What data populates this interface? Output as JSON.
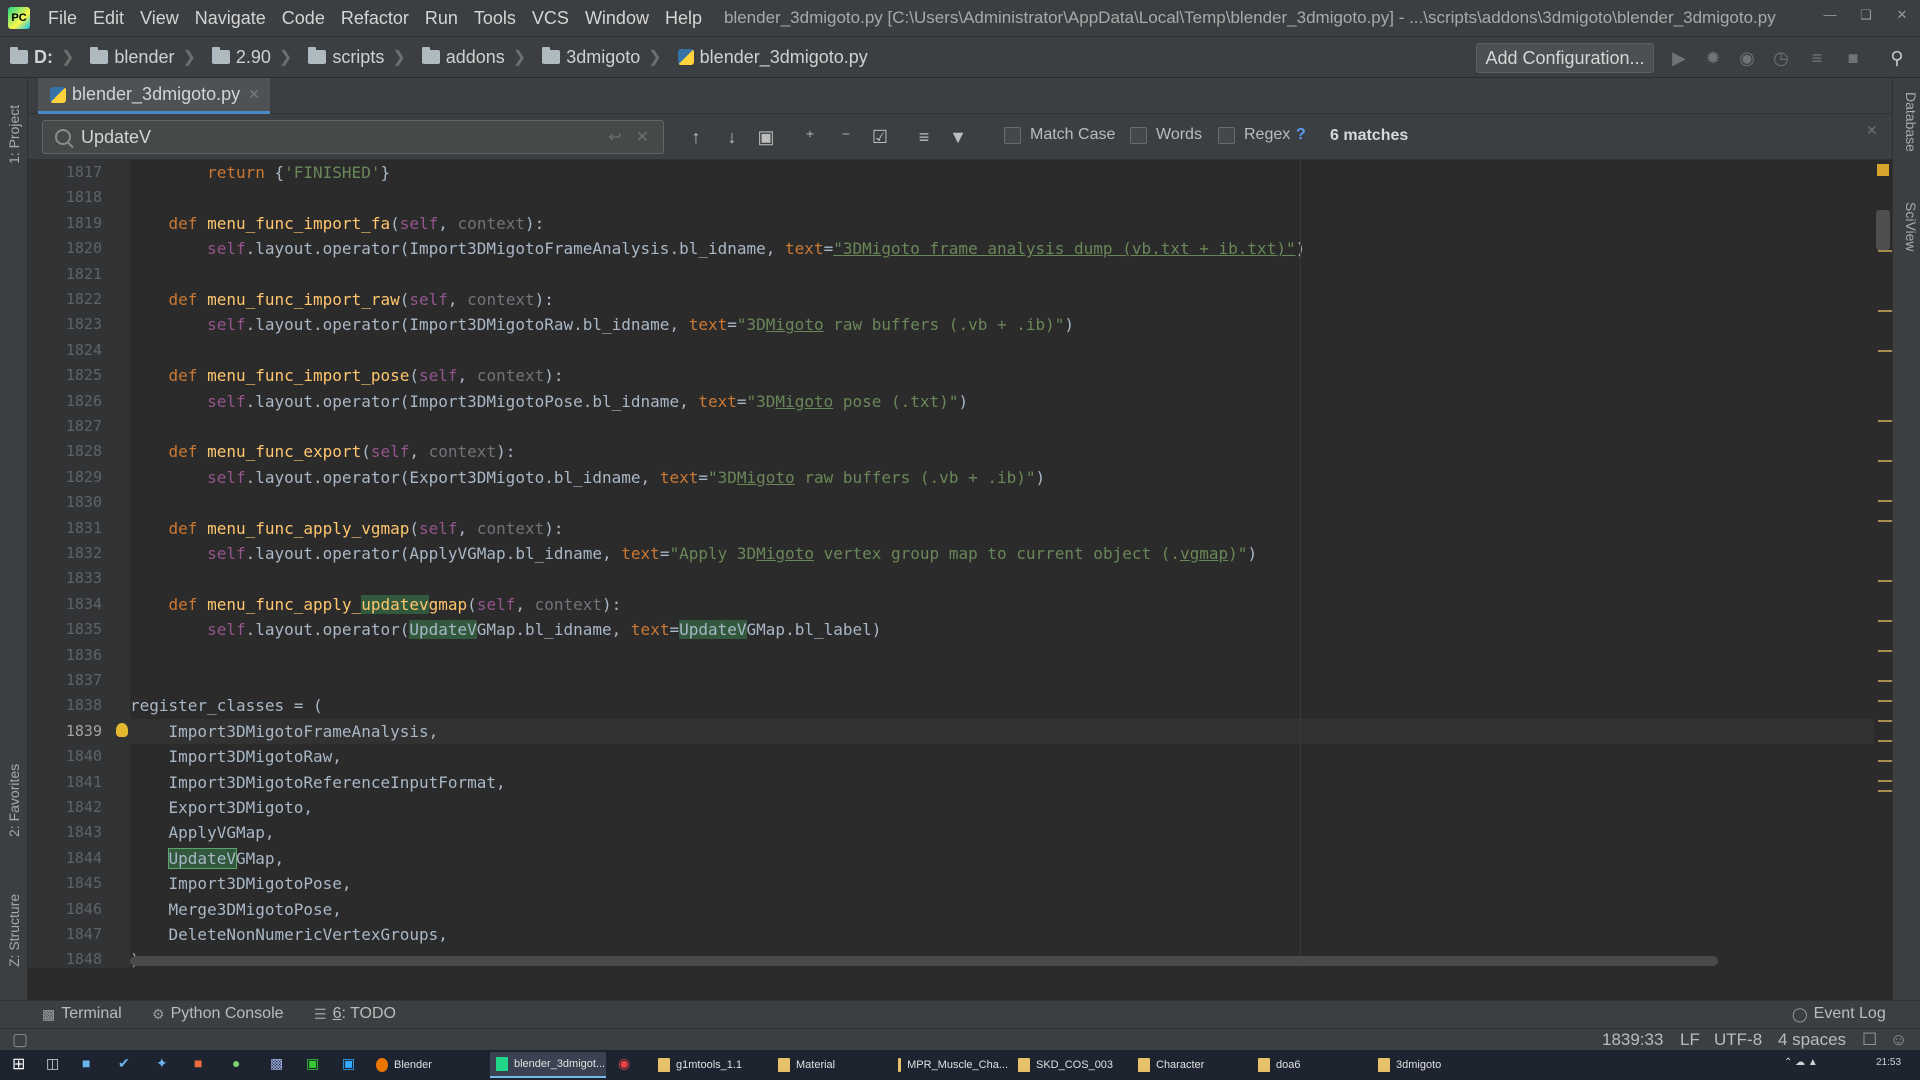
{
  "window": {
    "title": "blender_3dmigoto.py [C:\\Users\\Administrator\\AppData\\Local\\Temp\\blender_3dmigoto.py] - ...\\scripts\\addons\\3dmigoto\\blender_3dmigoto.py",
    "menu": [
      "File",
      "Edit",
      "View",
      "Navigate",
      "Code",
      "Refactor",
      "Run",
      "Tools",
      "VCS",
      "Window",
      "Help"
    ]
  },
  "breadcrumbs": [
    "D:",
    "blender",
    "2.90",
    "scripts",
    "addons",
    "3dmigoto",
    "blender_3dmigoto.py"
  ],
  "toolbar": {
    "add_configuration": "Add Configuration..."
  },
  "tool_windows": {
    "project": "1: Project",
    "favorites": "2: Favorites",
    "structure": "Z: Structure",
    "database": "Database",
    "sciview": "SciView"
  },
  "editor_tab": {
    "label": "blender_3dmigoto.py"
  },
  "search": {
    "value": "UpdateV",
    "match_case_label": "Match Case",
    "words_label": "Words",
    "regex_label": "Regex",
    "help": "?",
    "matches": "6 matches"
  },
  "line_numbers": [
    "1817",
    "1818",
    "1819",
    "1820",
    "1821",
    "1822",
    "1823",
    "1824",
    "1825",
    "1826",
    "1827",
    "1828",
    "1829",
    "1830",
    "1831",
    "1832",
    "1833",
    "1834",
    "1835",
    "1836",
    "1837",
    "1838",
    "1839",
    "1840",
    "1841",
    "1842",
    "1843",
    "1844",
    "1845",
    "1846",
    "1847",
    "1848"
  ],
  "code": {
    "l1817": [
      "        ",
      "return",
      " {",
      "'FINISHED'",
      "}"
    ],
    "l1819": [
      "    ",
      "def",
      " ",
      "menu_func_import_fa",
      "(",
      "self",
      ", ",
      "context",
      "):"
    ],
    "l1820": [
      "        ",
      "self",
      ".layout.operator(Import3DMigotoFrameAnalysis.bl_idname, ",
      "text",
      "=",
      "\"3DMigoto frame analysis dump (vb.txt + ib.txt)\"",
      ")"
    ],
    "l1822": [
      "    ",
      "def",
      " ",
      "menu_func_import_raw",
      "(",
      "self",
      ", ",
      "context",
      "):"
    ],
    "l1823": [
      "        ",
      "self",
      ".layout.operator(Import3DMigotoRaw.bl_idname, ",
      "text",
      "=",
      "\"3D",
      "Migoto",
      " raw buffers (.vb + .ib)\"",
      ")"
    ],
    "l1825": [
      "    ",
      "def",
      " ",
      "menu_func_import_pose",
      "(",
      "self",
      ", ",
      "context",
      "):"
    ],
    "l1826": [
      "        ",
      "self",
      ".layout.operator(Import3DMigotoPose.bl_idname, ",
      "text",
      "=",
      "\"3D",
      "Migoto",
      " pose (.txt)\"",
      ")"
    ],
    "l1828": [
      "    ",
      "def",
      " ",
      "menu_func_export",
      "(",
      "self",
      ", ",
      "context",
      "):"
    ],
    "l1829": [
      "        ",
      "self",
      ".layout.operator(Export3DMigoto.bl_idname, ",
      "text",
      "=",
      "\"3D",
      "Migoto",
      " raw buffers (.vb + .ib)\"",
      ")"
    ],
    "l1831": [
      "    ",
      "def",
      " ",
      "menu_func_apply_vgmap",
      "(",
      "self",
      ", ",
      "context",
      "):"
    ],
    "l1832": [
      "        ",
      "self",
      ".layout.operator(ApplyVGMap.bl_idname, ",
      "text",
      "=",
      "\"Apply 3D",
      "Migoto",
      " vertex group map to current object (.",
      "vgmap",
      ")\"",
      ")"
    ],
    "l1834": [
      "    ",
      "def",
      " ",
      "menu_func_apply_",
      "updatev",
      "gmap",
      "(",
      "self",
      ", ",
      "context",
      "):"
    ],
    "l1835": [
      "        ",
      "self",
      ".layout.operator(",
      "UpdateV",
      "GMap.bl_idname, ",
      "text",
      "=",
      "UpdateV",
      "GMap.bl_label)"
    ],
    "l1838": [
      "register_classes = ("
    ],
    "l1839": [
      "    Import3DMigotoFrameAnalysis,"
    ],
    "l1840": [
      "    Import3DMigotoRaw,"
    ],
    "l1841": [
      "    Import3DMigotoReferenceInputFormat,"
    ],
    "l1842": [
      "    Export3DMigoto,"
    ],
    "l1843": [
      "    ApplyVGMap,"
    ],
    "l1844": [
      "    ",
      "UpdateV",
      "GMap,"
    ],
    "l1845": [
      "    Import3DMigotoPose,"
    ],
    "l1846": [
      "    Merge3DMigotoPose,"
    ],
    "l1847": [
      "    DeleteNonNumericVertexGroups,"
    ],
    "l1848": [
      ")"
    ]
  },
  "bottom_tabs": {
    "terminal": "Terminal",
    "python_console": "Python Console",
    "todo_num": "6",
    "todo": ": TODO",
    "event_log": "Event Log"
  },
  "status": {
    "position": "1839:33",
    "line_sep": "LF",
    "encoding": "UTF-8",
    "indent": "4 spaces"
  },
  "taskbar": {
    "items": [
      "Blender",
      "blender_3dmigot...",
      "g1mtools_1.1",
      "Material",
      "MPR_Muscle_Cha...",
      "SKD_COS_003",
      "Character",
      "doa6",
      "3dmigoto"
    ],
    "clock": "21:53"
  },
  "colors": {
    "accent": "#4a88c7",
    "match_highlight": "#32593d",
    "keyword": "#cc7832",
    "function": "#ffc66d",
    "string": "#6a8759",
    "self": "#94558d"
  }
}
